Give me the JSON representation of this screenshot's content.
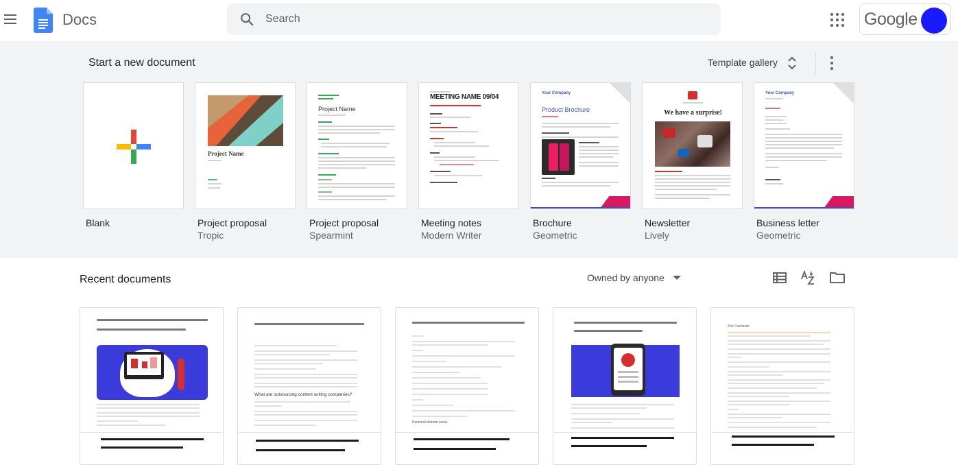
{
  "app": {
    "name": "Docs"
  },
  "search": {
    "placeholder": "Search"
  },
  "account": {
    "brand": "Google"
  },
  "templates": {
    "heading": "Start a new document",
    "gallery_label": "Template gallery",
    "items": [
      {
        "title": "Blank",
        "subtitle": ""
      },
      {
        "title": "Project proposal",
        "subtitle": "Tropic",
        "thumb_text": "Project Name"
      },
      {
        "title": "Project proposal",
        "subtitle": "Spearmint",
        "thumb_text": "Project Name"
      },
      {
        "title": "Meeting notes",
        "subtitle": "Modern Writer",
        "thumb_text": "MEETING NAME 09/04"
      },
      {
        "title": "Brochure",
        "subtitle": "Geometric",
        "thumb_text": "Product Brochure"
      },
      {
        "title": "Newsletter",
        "subtitle": "Lively",
        "thumb_text": "We have a surprise!"
      },
      {
        "title": "Business letter",
        "subtitle": "Geometric",
        "thumb_text": "Your Company"
      }
    ]
  },
  "recent": {
    "title": "Recent documents",
    "owner_filter": "Owned by anyone",
    "snippets": [
      "What are outsourcing content writing companies?",
      "Personal domain name",
      "Zoe Cushman"
    ]
  },
  "colors": {
    "docs_blue": "#4285f4",
    "avatar": "#1a1aff",
    "template_bg": "#f1f3f4",
    "illustration_blue": "#3b3bdc",
    "accent_pink": "#d81b60"
  },
  "icons": [
    "menu-icon",
    "docs-logo-icon",
    "search-icon",
    "apps-icon",
    "unfold-icon",
    "more-vert-icon",
    "list-view-icon",
    "sort-az-icon",
    "folder-icon",
    "caret-down-icon"
  ]
}
